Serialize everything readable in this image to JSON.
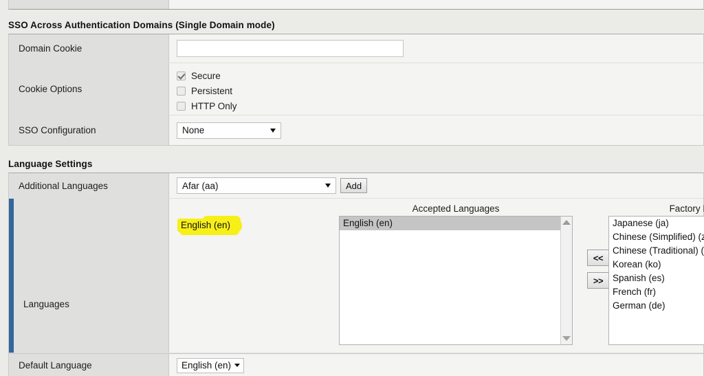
{
  "sso_section": {
    "title": "SSO Across Authentication Domains (Single Domain mode)",
    "rows": {
      "domain_cookie_label": "Domain Cookie",
      "domain_cookie_value": "",
      "domain_cookie_placeholder": "",
      "cookie_options_label": "Cookie Options",
      "cookie_options": [
        {
          "label": "Secure",
          "checked": true
        },
        {
          "label": "Persistent",
          "checked": false
        },
        {
          "label": "HTTP Only",
          "checked": false
        }
      ],
      "sso_configuration_label": "SSO Configuration",
      "sso_configuration_value": "None"
    }
  },
  "language_section": {
    "title": "Language Settings",
    "additional_languages_label": "Additional Languages",
    "additional_languages_value": "Afar (aa)",
    "add_button_label": "Add",
    "languages_label": "Languages",
    "accepted_caption": "Accepted Languages",
    "accepted_items": [
      {
        "label": "English (en)",
        "selected": true
      }
    ],
    "builtin_caption": "Factory BuiltIn Languages",
    "builtin_items": [
      {
        "label": "Japanese (ja)",
        "selected": false
      },
      {
        "label": "Chinese (Simplified) (zh-cn)",
        "selected": false
      },
      {
        "label": "Chinese (Traditional) (zh-tw)",
        "selected": false
      },
      {
        "label": "Korean (ko)",
        "selected": false
      },
      {
        "label": "Spanish (es)",
        "selected": false
      },
      {
        "label": "French (fr)",
        "selected": false
      },
      {
        "label": "German (de)",
        "selected": false
      }
    ],
    "move_left_label": "<<",
    "move_right_label": ">>",
    "default_language_label": "Default Language",
    "default_language_value": "English (en)"
  },
  "annotation": {
    "highlight_text": "English (en)",
    "highlight_color": "#f7ef18"
  },
  "accent_color": "#33679b"
}
